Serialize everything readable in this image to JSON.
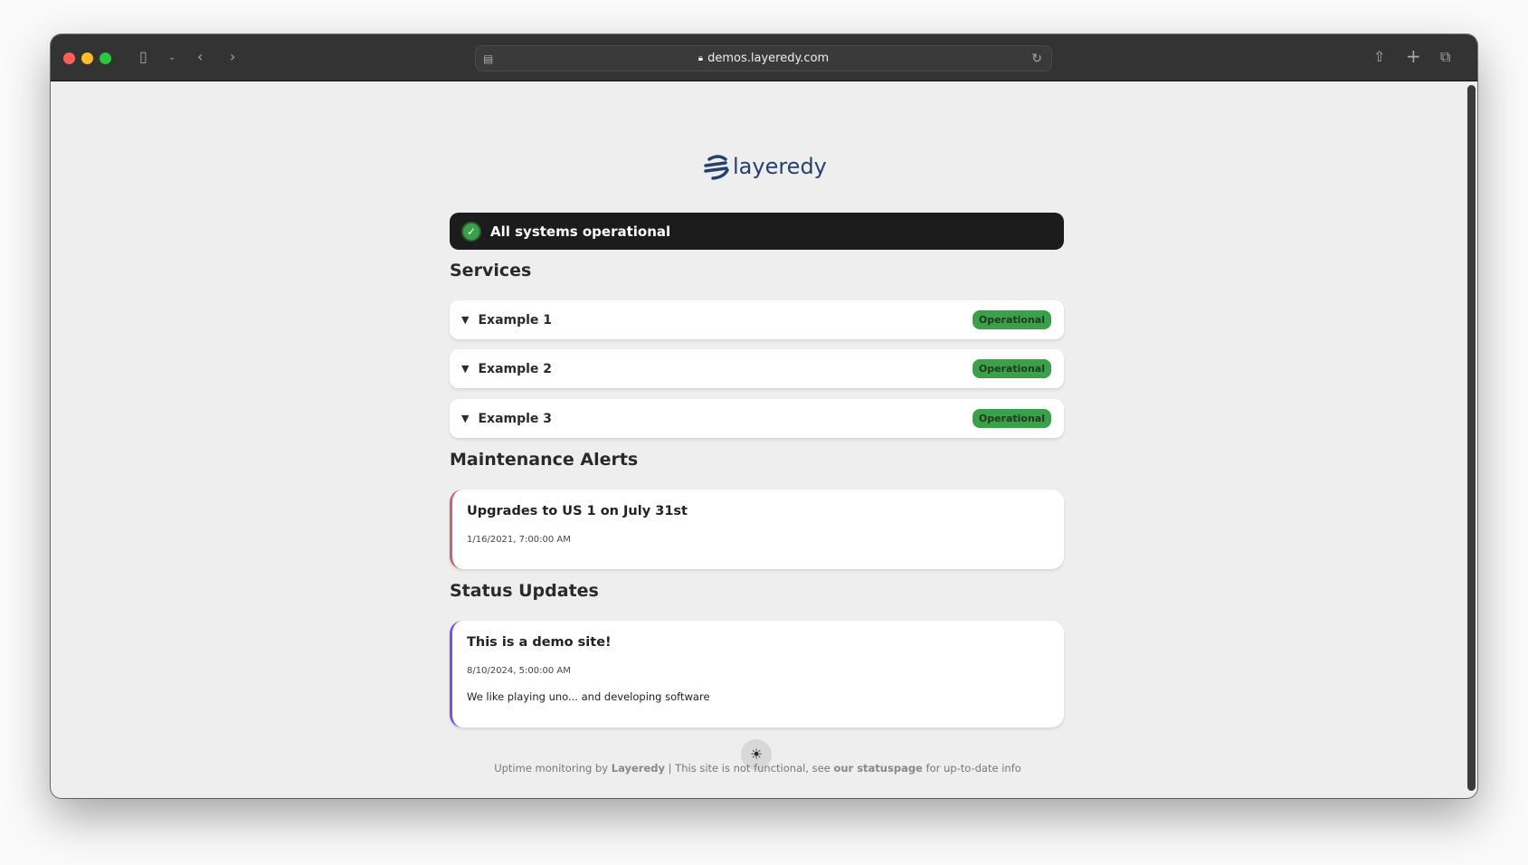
{
  "browser": {
    "url": "demos.layeredy.com"
  },
  "logo": {
    "text": "layeredy",
    "color": "#24406e"
  },
  "banner": {
    "text": "All systems operational"
  },
  "services": {
    "heading": "Services",
    "items": [
      {
        "name": "Example 1",
        "status": "Operational"
      },
      {
        "name": "Example 2",
        "status": "Operational"
      },
      {
        "name": "Example 3",
        "status": "Operational"
      }
    ]
  },
  "maintenance": {
    "heading": "Maintenance Alerts",
    "items": [
      {
        "title": "Upgrades to US 1 on July 31st",
        "date": "1/16/2021, 7:00:00 AM",
        "accent": "#d06070"
      }
    ]
  },
  "updates": {
    "heading": "Status Updates",
    "items": [
      {
        "title": "This is a demo site!",
        "date": "8/10/2024, 5:00:00 AM",
        "body": "We like playing uno... and developing software",
        "accent": "#7b4cf0"
      }
    ]
  },
  "theme_toggle": {
    "icon": "sun-icon"
  },
  "footer": {
    "prefix": "Uptime monitoring by ",
    "brand": "Layeredy",
    "middle": " | This site is not functional, see ",
    "link": "our statuspage",
    "suffix": " for up-to-date info"
  },
  "colors": {
    "operational": "#3aa14a",
    "banner_bg": "#1c1c1c",
    "page_bg": "#eeeeee"
  }
}
